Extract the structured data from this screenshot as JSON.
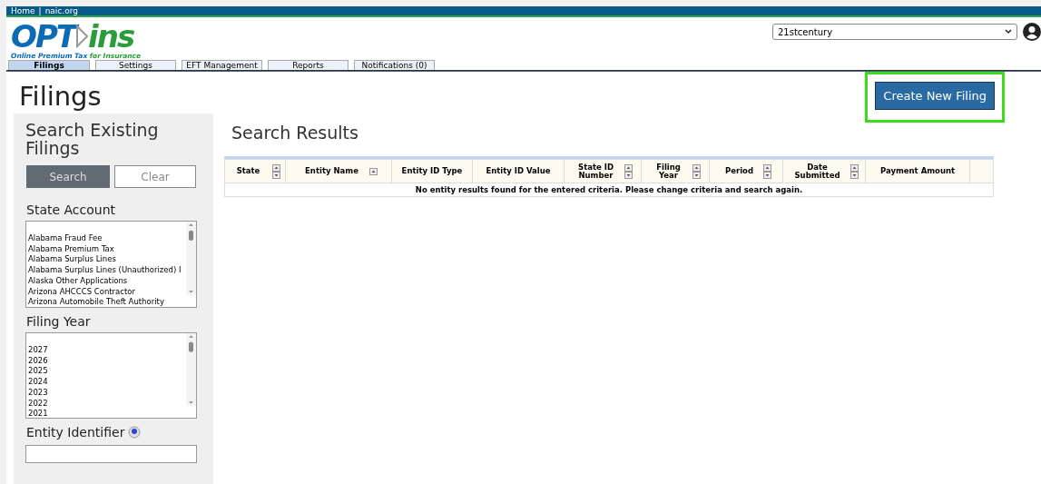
{
  "top_bar": {
    "links": [
      "Home",
      "naic.org"
    ],
    "separator": "|"
  },
  "logo": {
    "word_left": "OPT",
    "word_right": "ins",
    "tagline_left": "Online Premium Tax",
    "tagline_right": "for Insurance"
  },
  "company_select": {
    "value": "21stcentury"
  },
  "tabs": [
    {
      "label": "Filings",
      "selected": true
    },
    {
      "label": "Settings",
      "selected": false
    },
    {
      "label": "EFT Management",
      "selected": false
    },
    {
      "label": "Reports",
      "selected": false
    },
    {
      "label": "Notifications (0)",
      "selected": false
    }
  ],
  "page_title": "Filings",
  "create_button": {
    "label": "Create New Filing",
    "highlighted": true
  },
  "sidebar": {
    "title": "Search Existing Filings",
    "search_button": "Search",
    "clear_button": "Clear",
    "state_account": {
      "label": "State Account",
      "options": [
        "Alabama Fraud Fee",
        "Alabama Premium Tax",
        "Alabama Surplus Lines",
        "Alabama Surplus Lines (Unauthorized) I",
        "Alaska Other Applications",
        "Arizona AHCCCS Contractor",
        "Arizona Automobile Theft Authority"
      ]
    },
    "filing_year": {
      "label": "Filing Year",
      "options": [
        "2027",
        "2026",
        "2025",
        "2024",
        "2023",
        "2022",
        "2021"
      ]
    },
    "entity_identifier": {
      "label": "Entity Identifier"
    }
  },
  "results": {
    "title": "Search Results",
    "columns": [
      {
        "label": "State",
        "kind": "sortable"
      },
      {
        "label": "Entity Name",
        "kind": "ascending"
      },
      {
        "label": "Entity ID Type",
        "kind": "plain"
      },
      {
        "label": "Entity ID Value",
        "kind": "plain"
      },
      {
        "label": "State ID Number",
        "kind": "sortable"
      },
      {
        "label": "Filing Year",
        "kind": "sortable"
      },
      {
        "label": "Period",
        "kind": "sortable"
      },
      {
        "label": "Date Submitted",
        "kind": "sortable"
      },
      {
        "label": "Payment Amount",
        "kind": "plain"
      }
    ],
    "empty_message": "No entity results found for the entered criteria. Please change criteria and search again."
  }
}
